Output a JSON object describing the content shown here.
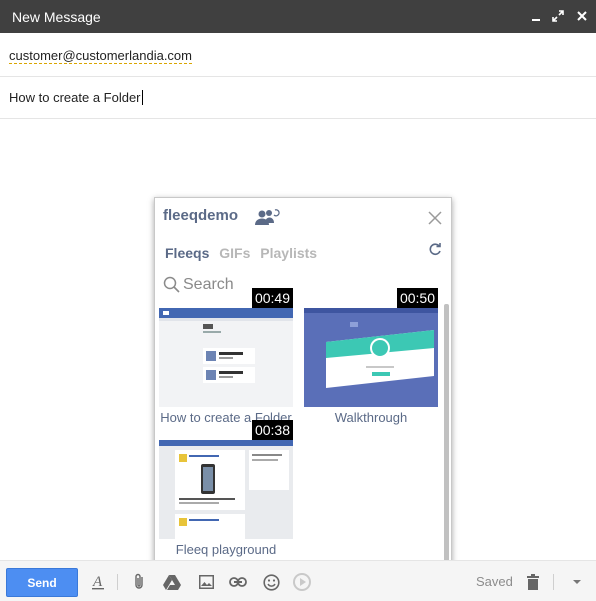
{
  "window": {
    "title": "New Message"
  },
  "to": {
    "recipient": "customer@customerlandia.com"
  },
  "subject": {
    "value": "How to create a Folder"
  },
  "fleeq_panel": {
    "brand": "fleeqdemo",
    "tabs": [
      {
        "label": "Fleeqs",
        "active": true
      },
      {
        "label": "GIFs",
        "active": false
      },
      {
        "label": "Playlists",
        "active": false
      }
    ],
    "search": {
      "placeholder": "Search"
    },
    "items": [
      {
        "title": "How to create a Folder",
        "duration": "00:49"
      },
      {
        "title": "Walkthrough",
        "duration": "00:50"
      },
      {
        "title": "Fleeq playground",
        "duration": "00:38"
      }
    ]
  },
  "toolbar": {
    "send_label": "Send",
    "status": "Saved"
  },
  "colors": {
    "titlebar": "#404040",
    "send_button": "#4d8ef2",
    "brand_text": "#5b6a87",
    "inactive_tab": "#b7b7b7"
  }
}
